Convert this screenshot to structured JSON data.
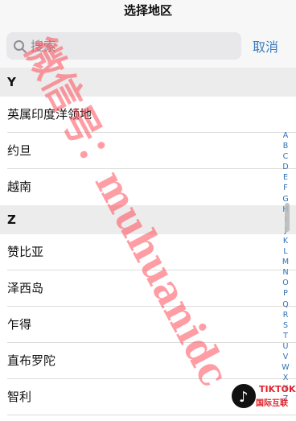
{
  "header": {
    "title": "选择地区"
  },
  "search": {
    "placeholder": "搜索",
    "value": "",
    "cancel_label": "取消"
  },
  "list": {
    "sections": [
      {
        "letter": "Y",
        "items": [
          "英属印度洋领地",
          "约旦",
          "越南"
        ]
      },
      {
        "letter": "Z",
        "items": [
          "赞比亚",
          "泽西岛",
          "乍得",
          "直布罗陀",
          "智利"
        ]
      }
    ]
  },
  "index_bar": {
    "letters": [
      "A",
      "B",
      "C",
      "D",
      "E",
      "F",
      "G",
      "H",
      "I",
      "J",
      "K",
      "L",
      "M",
      "N",
      "O",
      "P",
      "Q",
      "R",
      "S",
      "T",
      "U",
      "V",
      "W",
      "X",
      "Y",
      "Z"
    ]
  },
  "watermark": {
    "text": "微信号：muhuanidc",
    "color": "#ff4d5a"
  },
  "badge": {
    "line1": "TIKTOK",
    "line2": "国际互联",
    "icon": "tiktok-note-icon"
  },
  "colors": {
    "accent": "#3a7bbf",
    "section_bg": "#ececec",
    "watermark": "#ff4d5a"
  }
}
